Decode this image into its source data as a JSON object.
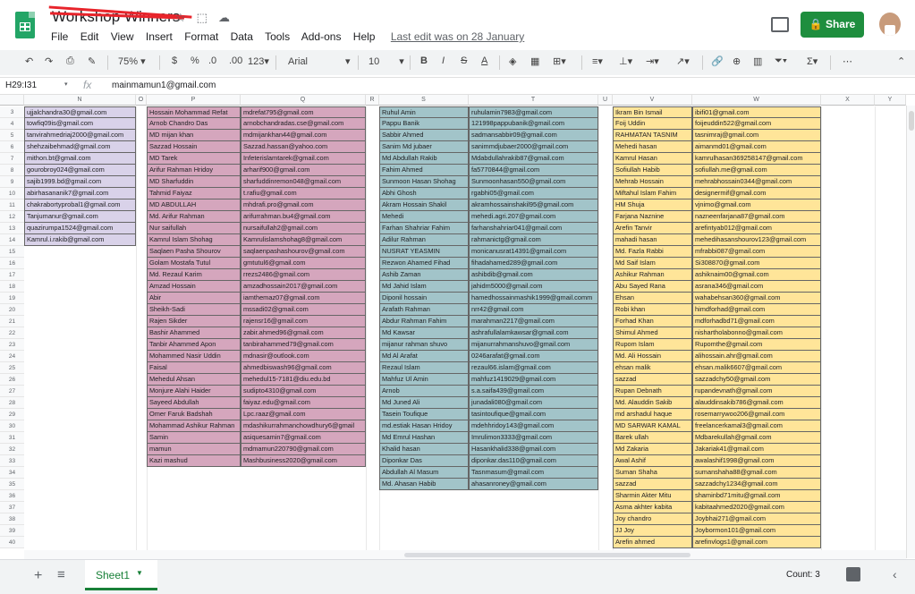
{
  "app": {
    "title": "Workshop Winners",
    "share_label": "Share",
    "last_edit": "Last edit was on 28 January"
  },
  "menu": [
    "File",
    "Edit",
    "View",
    "Insert",
    "Format",
    "Data",
    "Tools",
    "Add-ons",
    "Help"
  ],
  "toolbar": {
    "zoom": "75%",
    "currency": "$",
    "percent": "%",
    "dec_dec": ".0",
    "dec_inc": ".00",
    "more_formats": "123",
    "font": "Arial",
    "font_size": "10",
    "bold": "B",
    "italic": "I",
    "strike": "S",
    "text_color": "A"
  },
  "formula_bar": {
    "cell_ref": "H29:I31",
    "fx": "fx",
    "value": "mainmamun1@gmail.com"
  },
  "columns": [
    "N",
    "O",
    "P",
    "Q",
    "R",
    "S",
    "T",
    "U",
    "V",
    "W",
    "X",
    "Y"
  ],
  "rows": [
    "3",
    "4",
    "5",
    "6",
    "7",
    "8",
    "9",
    "10",
    "11",
    "12",
    "13",
    "14",
    "15",
    "16",
    "17",
    "18",
    "19",
    "20",
    "21",
    "22",
    "23",
    "24",
    "25",
    "26",
    "27",
    "28",
    "29",
    "30",
    "31",
    "32",
    "33",
    "34",
    "35",
    "36",
    "37",
    "38",
    "39",
    "40"
  ],
  "col_n": [
    "ujjalchandra30@gmail.com",
    "towfiq09is@gmail.com",
    "tanvirahmedriaj2000@gmail.com",
    "shehzaibehmad@gmail.com",
    "mithon.bt@gmail.com",
    "gourobroy024@gmail.com",
    "sajib1999.bd@gmail.com",
    "abirhasananik7@gmail.com",
    "chakrabortyprobal1@gmail.com",
    "Tanjumanur@gmail.com",
    "quazirumpa1524@gmail.com",
    "Kamrul.i.rakib@gmail.com"
  ],
  "col_p": [
    "Hossain Mohammad Refat",
    "Arnob Chandro Das",
    "MD mijan khan",
    "Sazzad Hossain",
    "MD Tarek",
    "Arifur Rahman Hridoy",
    "MD Sharfuddin",
    "Tahmid Faiyaz",
    "MD ABDULLAH",
    "Md. Arifur Rahman",
    "Nur saifullah",
    "Kamrul Islam Shohag",
    "Saqlaen Pasha Shourov",
    "Golam Mostafa Tutul",
    "Md. Rezaul Karim",
    "Amzad Hossain",
    "Abir",
    "Sheikh-Sadi",
    "Rajen Sikder",
    "Bashir Ahammed",
    "Tanbir Ahammed Apon",
    "Mohammed Nasir Uddin",
    "Faisal",
    "Mehedul Ahsan",
    "Monjure Alahi Haider",
    "Sayeed Abdullah",
    "Omer Faruk Badshah",
    "Mohammad Ashikur Rahman",
    "Samin",
    "mamun",
    "Kazi mashud"
  ],
  "col_q": [
    "mdrefat795@gmail.com",
    "arnobchandradas.cse@gmail.com",
    "mdmijankhan44@gmail.com",
    "Sazzad.hassan@yahoo.com",
    "Infeterislamtarek@gmail.com",
    "arharif900@gmail.com",
    "sharfuddinremon048@gmail.com",
    "t.rafiu@gmail.com",
    "mhdrafi.pro@gmail.com",
    "arifurrahman.bu4@gmail.com",
    "nursaifullah2@gmail.com",
    "Kamrulislamshohag8@gmail.com",
    "saqlaenpashashourov@gmail.com",
    "gmtutul6@gmail.com",
    "rrezs2486@gmail.com",
    "amzadhossain2017@gmail.com",
    "iamthemaz07@gmail.com",
    "mssadi02@gmail.com",
    "rajensr16@gmail.com",
    "zabir.ahmed96@gmail.com",
    "tanbirahammed79@gmail.com",
    "mdnasir@outlook.com",
    "ahmedbiswash96@gmail.com",
    "mehedul15-7181@diu.edu.bd",
    "sudipto4310@gmail.com",
    "faiyaz.edu@gmail.com",
    "Lpc.raaz@gmail.com",
    "mdashikurrahmanchowdhury6@gmail",
    "asiquesamin7@gmail.com",
    "mdmamun220790@gmail.com",
    "Mashbusiness2020@gmail.com"
  ],
  "col_s": [
    "Ruhul Amin",
    "Pappu Banik",
    "Sabbir Ahmed",
    "Sanim Md jubaer",
    "Md Abdullah Rakib",
    "Fahim Ahmed",
    "Sunmoon Hasan Shohag",
    "Abhi Ghosh",
    "Akram Hossain Shakil",
    "Mehedi",
    "Farhan Shahriar Fahim",
    "Adilur Rahman",
    "NUSRAT YEASMIN",
    "Rezwon Ahamed Fihad",
    "Ashib Zaman",
    "Md Jahid Islam",
    "Diponil hossain",
    "Arafath Rahman",
    "Abdur Rahman Fahim",
    "Md Kawsar",
    "mijanur rahman shuvo",
    "Md Al Arafat",
    "Rezaul Islam",
    "Mahfuz Ul Amin",
    "Arnob",
    "Md Juned Ali",
    "Tasein Toufique",
    "md.estiak Hasan Hridoy",
    "Md Emrul Hashan",
    "Khalid hasan",
    "Diponkar Das",
    "Abdullah Al Masum",
    "Md. Ahasan Habib"
  ],
  "col_t": [
    "ruhulamin7983@gmail.com",
    "121998pappubanik@gmail.com",
    "sadmansabbir09@gmail.com",
    "sanimmdjubaer2000@gmail.com",
    "Mdabdullahrakib87@gmail.com",
    "fa5770844@gmail.com",
    "Sunmoonhasan550@gmail.com",
    "rgabhi05@gmail.com",
    "akramhossainshakil95@gmail.com",
    "mehedi.agri.207@gmail.com",
    "farhanshahriar041@gmail.com",
    "rahmanictg@gmail.com",
    "monicanusrat14391@gmail.com",
    "fihadahamed289@gmail.com",
    "ashibdib@gmail.com",
    "jahidm5000@gmail.com",
    "hamedhossainmashik1999@gmail.comm",
    "nrr42@gmail.com",
    "marahman2217@gmail.com",
    "ashrafullalamkawsar@gmail.com",
    "mijanurrahmanshuvo@gmail.com",
    "0246arafat@gmail.com",
    "rezaul66.islam@gmail.com",
    "mahfuz1419029@gmail.com",
    "s.a.saifa439@gmail.com",
    "junadali080@gmail.com",
    "tasintoufique@gmail.com",
    "mdehhridoy143@gmail.com",
    "Imrulimon3333@gmail.com",
    "Hasankhalid338@gmail.com",
    "diponkar.das110@gmail.com",
    "Tasnmasum@gmail.com",
    "ahasanroney@gmail.com"
  ],
  "col_v": [
    "Ikram Bin Ismail",
    "Foij Uddin",
    "RAHMATAN TASNIM",
    "Mehedi hasan",
    "Kamrul Hasan",
    "Sofiullah Habib",
    "Mehrab Hossain",
    "Miftahul Islam Fahim",
    "HM Shuja",
    "Farjana Naznine",
    "Arefin Tanvir",
    "mahadi hasan",
    "Md. Fazla Rabbi",
    "Md Saif Islam",
    "Ashikur Rahman",
    "Abu Sayed Rana",
    "Ehsan",
    "Robi khan",
    "Forhad Khan",
    "Shimul Ahmed",
    "Rupom Islam",
    "Md. Ali Hossain",
    "ehsan malik",
    "sazzad",
    "Rupan Debnath",
    "Md. Alauddin Sakib",
    "md arshadul haque",
    "MD SARWAR KAMAL",
    "Barek ullah",
    "Md Zakaria",
    "Awal Ashif",
    "Suman Shaha",
    "sazzad",
    "Sharmin Akter Mitu",
    "Asma akhter kabita",
    "Joy chandro",
    "JJ Joy",
    "Arefin ahmed"
  ],
  "col_w": [
    "ibifi01@gmail.com",
    "foijeuddin522@gmail.com",
    "tasnimraj@gmail.com",
    "aimanmd01@gmail.com",
    "kamrulhasan369258147@gmail.com",
    "sofiullah.me@gmail.com",
    "mehrabhossain0344@gmail.com",
    "designermif@gmail.com",
    "vjnimo@gmail.com",
    "nazneenfarjana87@gmail.com",
    "arefintyab012@gmail.com",
    "mehedihasanshourov123@gmail.com",
    "mfrabbi087@gmail.com",
    "Si308870@gmail.com",
    "ashiknaim00@gmail.com",
    "asrana346@gmail.com",
    "wahabehsan360@gmail.com",
    "himdforhad@gmail.com",
    "mdforhadbd71@gmail.com",
    "nishartholabonno@gmail.com",
    "Rupomthe@gmail.com",
    "alihossain.ahr@gmail.com",
    "ehsan.malik6607@gmail.com",
    "sazzadchy50@gmail.com",
    "rupandevnath@gmail.com",
    "alauddinsakib786@gmail.com",
    "rosemarrywoo206@gmail.com",
    "freelancerkamal3@gmail.com",
    "Mdbarekullah@gmail.com",
    "Jakariak41@gmail.com",
    "awalashif1998@gmail.com",
    "sumanshaha88@gmail.com",
    "sazzadchy1234@gmail.com",
    "shaminbd71mitu@gmail.com",
    "kabitaahmed2020@gmail.com",
    "Joybhai271@gmail.com",
    "Joybormon101@gmail.com",
    "arefinvlogs1@gmail.com"
  ],
  "sheet": {
    "name": "Sheet1",
    "count": "Count: 3"
  }
}
